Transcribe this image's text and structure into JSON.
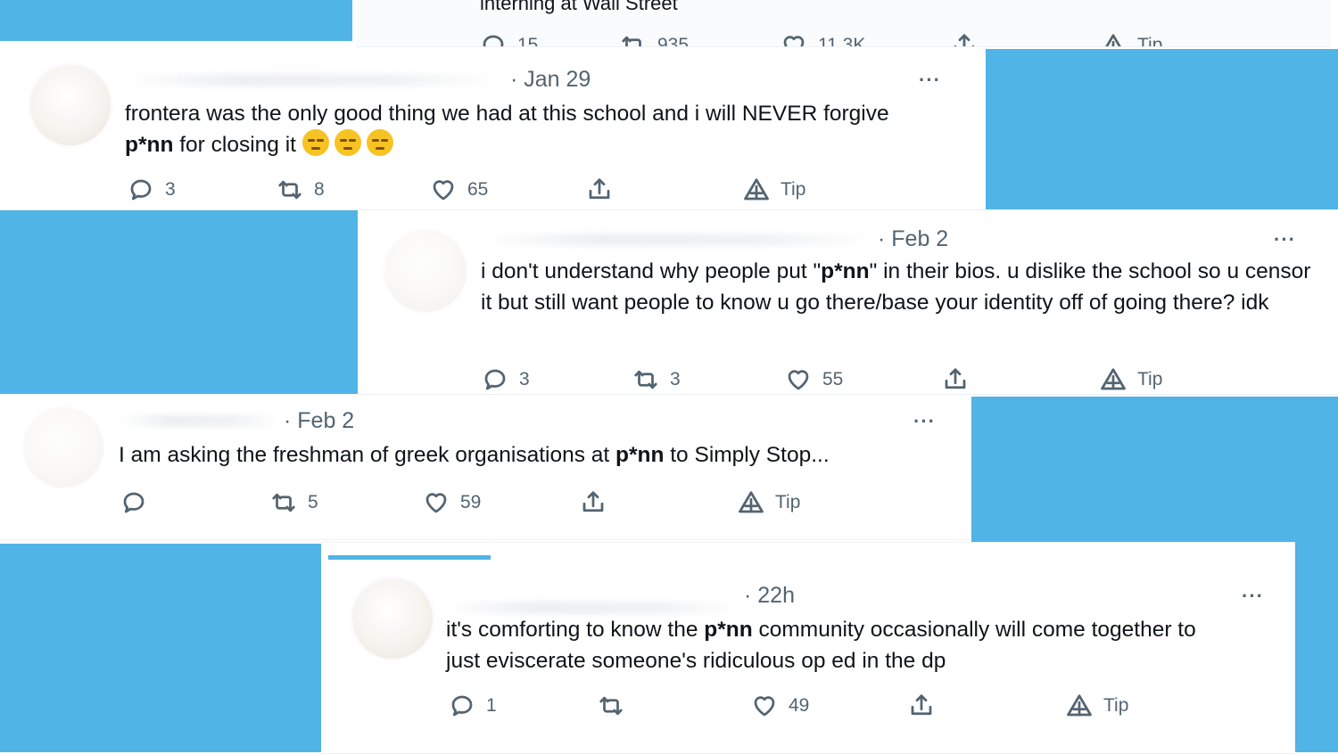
{
  "colors": {
    "accent_blue": "#50b4e6",
    "muted": "#536471",
    "text": "#0f1419"
  },
  "icons": {
    "reply": "speech-bubble-icon",
    "retweet": "retweet-icon",
    "like": "heart-icon",
    "share": "share-icon",
    "tip": "tip-icon",
    "more": "more-icon"
  },
  "top_tweet": {
    "text": "interning at Wall Street",
    "replies": "15",
    "retweets": "935",
    "likes": "11.3K",
    "tip": "Tip"
  },
  "tweets": [
    {
      "date": "· Jan 29",
      "more": "···",
      "text_a": "frontera was the only good thing we had at this school and i will NEVER forgive ",
      "text_bold": "p*nn",
      "text_b": " for closing it",
      "emoji": [
        "emoji-1",
        "emoji-2",
        "emoji-3"
      ],
      "replies": "3",
      "retweets": "8",
      "likes": "65",
      "tip": "Tip"
    },
    {
      "date": "· Feb 2",
      "more": "···",
      "text_a": "i don't understand why people put \"",
      "text_bold": "p*nn",
      "text_b": "\" in their bios. u dislike the school so u censor it but still want people to know u go there/base your identity off of going there? idk",
      "replies": "3",
      "retweets": "3",
      "likes": "55",
      "tip": "Tip"
    },
    {
      "date": "· Feb 2",
      "more": "···",
      "text_a": "I am asking the freshman of greek organisations at ",
      "text_bold": "p*nn",
      "text_b": " to Simply Stop...",
      "replies": "",
      "retweets": "5",
      "likes": "59",
      "tip": "Tip"
    },
    {
      "date": "· 22h",
      "more": "···",
      "text_a": "it's comforting to know the ",
      "text_bold": "p*nn",
      "text_b": " community occasionally will come together to just eviscerate someone's ridiculous op ed in the dp",
      "replies": "1",
      "retweets": "",
      "likes": "49",
      "tip": "Tip"
    }
  ]
}
